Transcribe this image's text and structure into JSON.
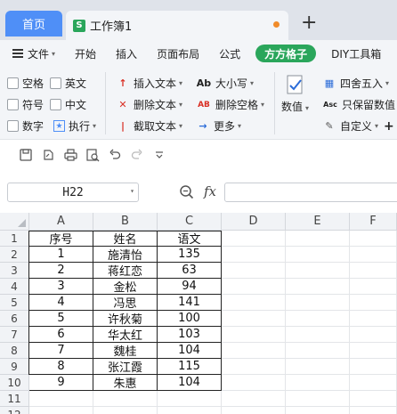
{
  "tabs": {
    "home": "首页",
    "doc_icon": "S",
    "doc_title": "工作簿1",
    "add": "+"
  },
  "ribbon_tabs": [
    "文件",
    "开始",
    "插入",
    "页面布局",
    "公式",
    "方方格子",
    "DIY工具箱"
  ],
  "ribbon_menu_caret": "▾",
  "ribbon": {
    "check_row1": [
      "空格",
      "英文"
    ],
    "check_row2": [
      "符号",
      "中文"
    ],
    "check_row3_label": "数字",
    "execute": "执行",
    "insert_text": "插入文本",
    "delete_text": "删除文本",
    "cut_text": "截取文本",
    "case": "大小写",
    "delete_space": "删除空格",
    "more": "更多",
    "value": "数值",
    "round": "四舍五入",
    "keep_value": "只保留数值",
    "custom": "自定义",
    "icons": {
      "insert": "↑",
      "delete": "✕",
      "cut": "|",
      "case": "Ab",
      "delete_space": "AB",
      "more": "→",
      "round": "▦",
      "keep_value": "Asc",
      "custom": "✎",
      "plus": "+"
    }
  },
  "formula_bar": {
    "name_box": "H22",
    "fx": "fx",
    "value": ""
  },
  "columns": [
    "A",
    "B",
    "C",
    "D",
    "E",
    "F"
  ],
  "rows": [
    "1",
    "2",
    "3",
    "4",
    "5",
    "6",
    "7",
    "8",
    "9",
    "10",
    "11",
    "12"
  ],
  "table": {
    "headers": [
      "序号",
      "姓名",
      "语文"
    ],
    "rows": [
      [
        "1",
        "施清怡",
        "135"
      ],
      [
        "2",
        "蒋红恋",
        "63"
      ],
      [
        "3",
        "金松",
        "94"
      ],
      [
        "4",
        "冯思",
        "141"
      ],
      [
        "5",
        "许秋菊",
        "100"
      ],
      [
        "6",
        "华太红",
        "103"
      ],
      [
        "7",
        "魏桂",
        "104"
      ],
      [
        "8",
        "张江霞",
        "115"
      ],
      [
        "9",
        "朱惠",
        "104"
      ]
    ]
  },
  "colors": {
    "home_tab": "#4f8ff7",
    "accent_green": "#2aa65b",
    "unsaved_dot": "#f08b2a"
  }
}
